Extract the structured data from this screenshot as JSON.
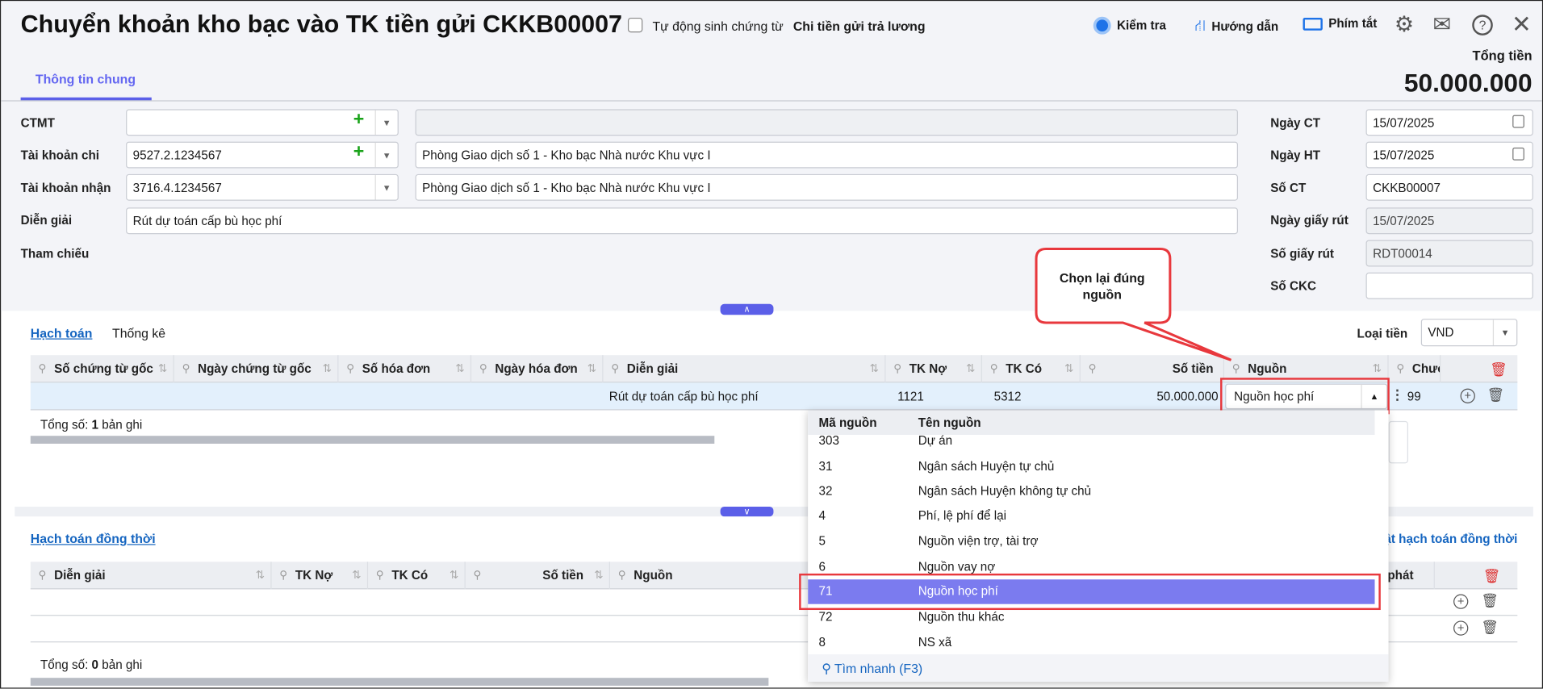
{
  "header": {
    "title": "Chuyển khoản kho bạc vào TK tiền gửi CKKB00007",
    "auto_label": "Tự động sinh chứng từ",
    "auto_type": "Chi tiền gửi trả lương",
    "actions": {
      "check": "Kiểm tra",
      "guide": "Hướng dẫn",
      "shortcuts": "Phím tắt"
    },
    "total_label": "Tổng tiền",
    "total_value": "50.000.000"
  },
  "tabs": {
    "general": "Thông tin chung"
  },
  "form": {
    "ctmt": {
      "label": "CTMT",
      "value": "",
      "desc": ""
    },
    "tk_chi": {
      "label": "Tài khoản chi",
      "value": "9527.2.1234567",
      "desc": "Phòng Giao dịch số 1 - Kho bạc Nhà nước Khu vực I"
    },
    "tk_nhan": {
      "label": "Tài khoản nhận",
      "value": "3716.4.1234567",
      "desc": "Phòng Giao dịch số 1 - Kho bạc Nhà nước Khu vực I"
    },
    "dien_giai": {
      "label": "Diễn giải",
      "value": "Rút dự toán cấp bù học phí"
    },
    "tham_chieu": {
      "label": "Tham chiếu"
    },
    "ngay_ct": {
      "label": "Ngày CT",
      "value": "15/07/2025"
    },
    "ngay_ht": {
      "label": "Ngày HT",
      "value": "15/07/2025"
    },
    "so_ct": {
      "label": "Số CT",
      "value": "CKKB00007"
    },
    "ngay_giay_rut": {
      "label": "Ngày giấy rút",
      "value": "15/07/2025"
    },
    "so_giay_rut": {
      "label": "Số giấy rút",
      "value": "RDT00014"
    },
    "so_ckc": {
      "label": "Số CKC",
      "value": ""
    }
  },
  "callout": "Chọn lại đúng nguồn",
  "detail": {
    "tab_hach_toan": "Hạch toán",
    "tab_thong_ke": "Thống kê",
    "currency_label": "Loại tiền",
    "currency": "VND",
    "columns": [
      "Số chứng từ gốc",
      "Ngày chứng từ gốc",
      "Số hóa đơn",
      "Ngày hóa đơn",
      "Diễn giải",
      "TK Nợ",
      "TK Có",
      "Số tiền",
      "Nguồn",
      "Chươ"
    ],
    "row": {
      "dien_giai": "Rút dự toán cấp bù học phí",
      "tk_no": "1121",
      "tk_co": "5312",
      "so_tien": "50.000.000",
      "nguon": "Nguồn học phí",
      "chuong": "99"
    },
    "total_prefix": "Tổng số: ",
    "total_count": "1",
    "total_suffix": " bản ghi"
  },
  "concurrent": {
    "title": "Hạch toán đồng thời",
    "update_link": "Cập nhật hạch toán đồng thời",
    "columns": [
      "Diễn giải",
      "TK Nợ",
      "TK Có",
      "Số tiền",
      "Nguồn",
      "phát"
    ],
    "total_prefix": "Tổng số: ",
    "total_count": "0",
    "total_suffix": " bản ghi"
  },
  "dropdown": {
    "col_code": "Mã nguồn",
    "col_name": "Tên nguồn",
    "items": [
      {
        "code": "303",
        "name": "Dự án"
      },
      {
        "code": "31",
        "name": "Ngân sách Huyện tự chủ"
      },
      {
        "code": "32",
        "name": "Ngân sách Huyện không tự chủ"
      },
      {
        "code": "4",
        "name": "Phí, lệ phí để lại"
      },
      {
        "code": "5",
        "name": "Nguồn viện trợ, tài trợ"
      },
      {
        "code": "6",
        "name": "Nguồn vay nợ"
      },
      {
        "code": "71",
        "name": "Nguồn học phí"
      },
      {
        "code": "72",
        "name": "Nguồn thu khác"
      },
      {
        "code": "8",
        "name": "NS xã"
      }
    ],
    "selected": "71",
    "quick_search": "Tìm nhanh (F3)"
  },
  "colors": {
    "accent": "#5b5fe8",
    "highlight": "#7b7bef",
    "link": "#1565c0",
    "red": "#e8383d"
  }
}
